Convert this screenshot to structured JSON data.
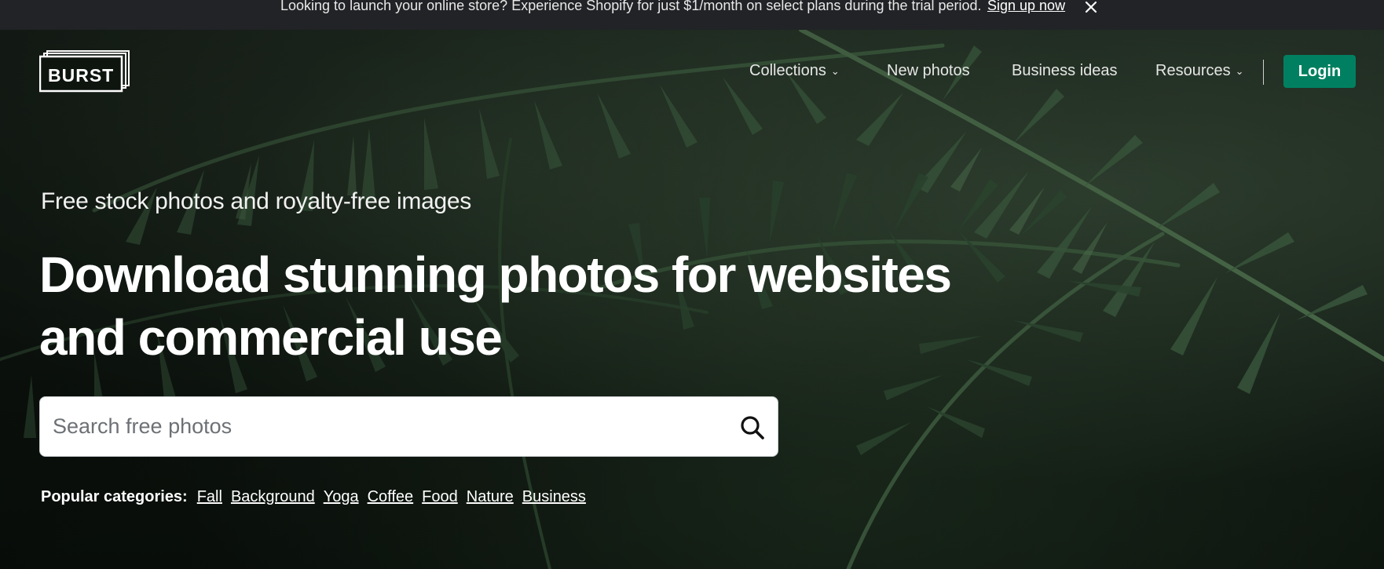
{
  "announcement": {
    "message": "Looking to launch your online store? Experience Shopify for just $1/month on select plans during the trial period.",
    "cta": "Sign up now",
    "close_icon": "close-icon"
  },
  "brand": {
    "logo_text": "BURST"
  },
  "nav": {
    "items": [
      {
        "label": "Collections",
        "dropdown": true
      },
      {
        "label": "New photos",
        "dropdown": false
      },
      {
        "label": "Business ideas",
        "dropdown": false
      },
      {
        "label": "Resources",
        "dropdown": true
      }
    ],
    "login_label": "Login"
  },
  "hero": {
    "kicker": "Free stock photos and royalty-free images",
    "headline_line1": "Download stunning photos for websites",
    "headline_line2": "and commercial use"
  },
  "search": {
    "placeholder": "Search free photos",
    "value": "",
    "icon": "search-icon"
  },
  "popular": {
    "label": "Popular categories:",
    "categories": [
      "Fall",
      "Background",
      "Yoga",
      "Coffee",
      "Food",
      "Nature",
      "Business"
    ]
  },
  "colors": {
    "announcement_bg": "#212326",
    "login_bg": "#008060",
    "hero_bg": "#101812"
  }
}
